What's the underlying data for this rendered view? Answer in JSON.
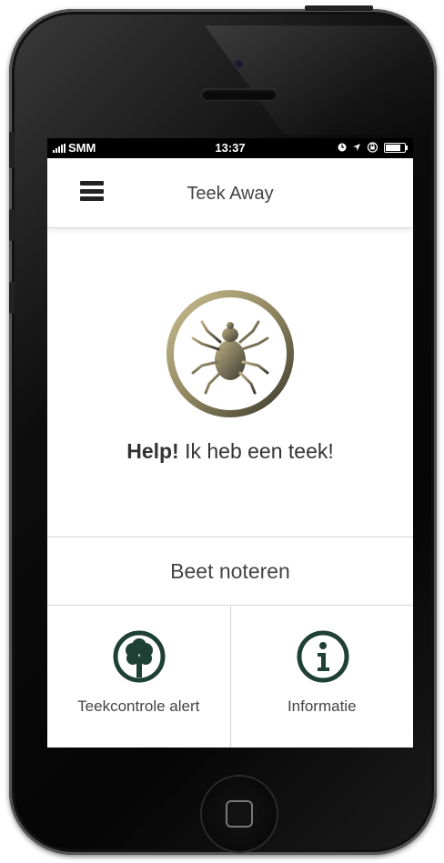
{
  "status_bar": {
    "carrier": "SMM",
    "time": "13:37",
    "icons": [
      "signal-bars-icon",
      "clock-icon",
      "location-arrow-icon",
      "orientation-lock-icon",
      "battery-icon"
    ]
  },
  "header": {
    "title": "Teek Away",
    "menu_icon": "hamburger-menu-icon"
  },
  "hero": {
    "icon": "tick-icon",
    "text_bold": "Help!",
    "text_rest": " Ik heb een teek!"
  },
  "actions": {
    "beet_label": "Beet noteren",
    "tiles": [
      {
        "label": "Teekcontrole alert",
        "icon": "tree-icon"
      },
      {
        "label": "Informatie",
        "icon": "info-icon"
      }
    ]
  },
  "colors": {
    "accent_gold": "#b8a77a",
    "accent_dark": "#3d3d33",
    "icon_green": "#1f4034"
  }
}
